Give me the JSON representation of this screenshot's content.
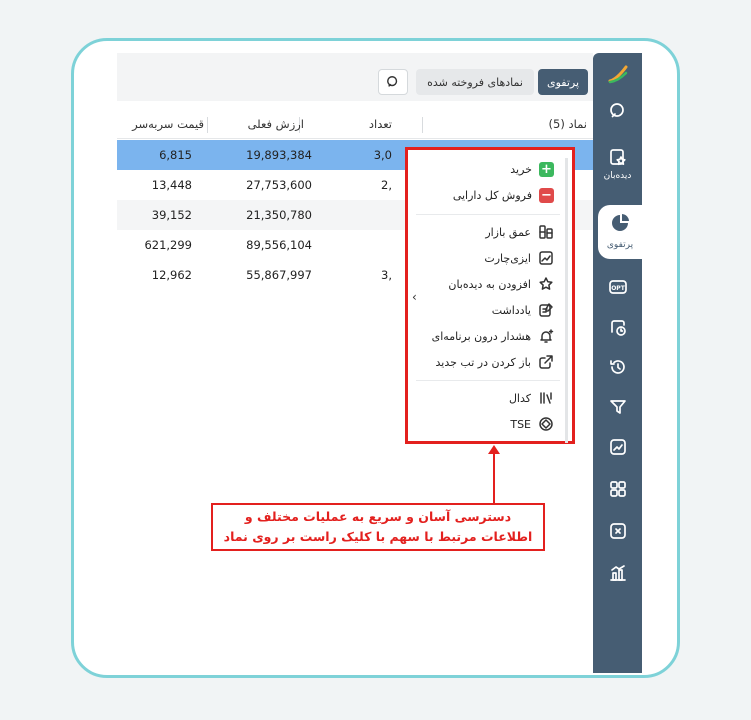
{
  "tabs": {
    "active": "پرتفوی",
    "sold": "نمادهای فروخته شده"
  },
  "sidebar": {
    "items": [
      {
        "icon": "search-icon"
      },
      {
        "icon": "watchlist-icon",
        "label": "دیده‌بان"
      },
      {
        "icon": "portfolio-pie-icon",
        "label": "پرتفوی"
      },
      {
        "icon": "opt-icon"
      },
      {
        "icon": "orders-clock-icon"
      },
      {
        "icon": "history-icon"
      },
      {
        "icon": "filter-icon"
      },
      {
        "icon": "chart-icon"
      },
      {
        "icon": "grid-apps-icon"
      },
      {
        "icon": "calculator-icon"
      },
      {
        "icon": "reports-icon"
      }
    ]
  },
  "table": {
    "columns": [
      "نماد (5)",
      "تعداد",
      "ارزش فعلی",
      "قیمت سربه‌سر"
    ],
    "rows": [
      {
        "count": "3,0",
        "value": "19,893,384",
        "breakeven": "6,815"
      },
      {
        "count": "2,",
        "value": "27,753,600",
        "breakeven": "13,448"
      },
      {
        "count": "",
        "value": "21,350,780",
        "breakeven": "39,152"
      },
      {
        "count": "",
        "value": "89,556,104",
        "breakeven": "621,299"
      },
      {
        "count": "3,",
        "value": "55,867,997",
        "breakeven": "12,962"
      }
    ]
  },
  "context_menu": {
    "buy": "خرید",
    "sell_all": "فروش کل دارایی",
    "market_depth": "عمق بازار",
    "easy_chart": "ایزی‌چارت",
    "add_watchlist": "افزودن به دیده‌بان",
    "note": "یادداشت",
    "in_app_alert": "هشدار درون برنامه‌ای",
    "open_new_tab": "باز کردن در تب جدید",
    "codal": "کدال",
    "tse": "TSE"
  },
  "callout": {
    "line1": "دسترسی آسان و سریع به عملیات مختلف و",
    "line2": "اطلاعات مرتبط با سهم با کلیک راست بر روی نماد"
  },
  "colors": {
    "sidebar": "#465d73",
    "highlight_row": "#7bb4ee",
    "annotation_red": "#e3201e",
    "frame_border": "#7ed2d8"
  }
}
